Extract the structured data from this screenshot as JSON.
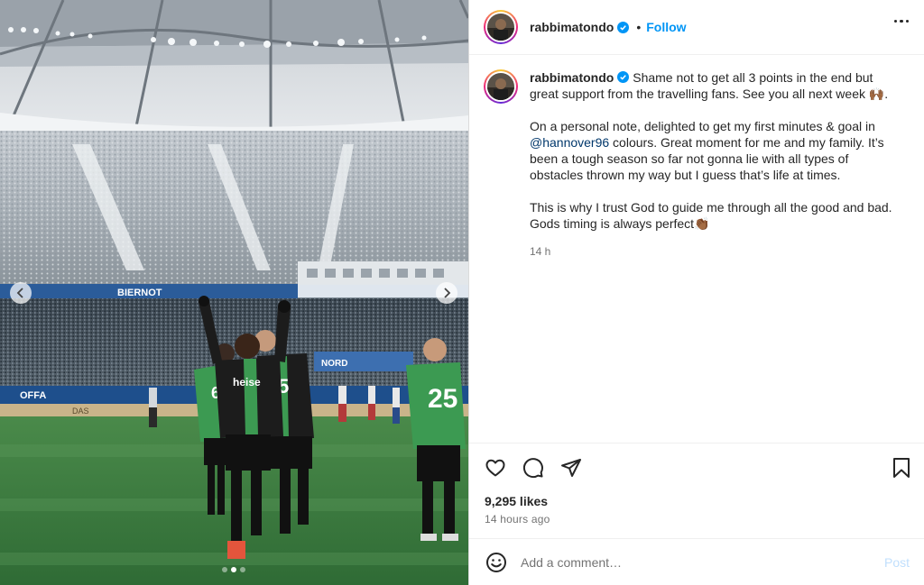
{
  "media": {
    "banner_text": "BIERNOT",
    "ad_board_left": "OFFA",
    "ad_board_mid": "DAS",
    "sign_right": "NORD",
    "jersey_sponsor": "heise",
    "jersey_number_main": "25",
    "jersey_number_center": "5",
    "jersey_number_left": "6",
    "carousel_dots": 3,
    "active_dot": 1
  },
  "header": {
    "username": "rabbimatondo",
    "separator": "•",
    "follow_label": "Follow"
  },
  "caption": {
    "username": "rabbimatondo",
    "paragraph1": "Shame not to get all 3 points in the end but great support from the travelling fans. See you all next week 🙌🏾.",
    "paragraph2_before": "On a personal note, delighted to get my first minutes & goal in ",
    "mention": "@hannover96",
    "paragraph2_after": " colours. Great moment for me and my family. It’s been a tough season so far not gonna lie with all types of obstacles thrown my way but I guess that’s life at times.",
    "paragraph3": "This is why I trust God to guide me through all the good and bad. Gods timing is always perfect👏🏾",
    "time": "14 h"
  },
  "actions": {
    "likes": "9,295 likes",
    "posted": "14 hours ago"
  },
  "comment": {
    "placeholder": "Add a comment…",
    "post_label": "Post"
  },
  "colors": {
    "accent": "#0095f6",
    "mention": "#00376b",
    "post_disabled": "#c0dffd",
    "hannover_green": "#2e8a46"
  },
  "icons": [
    "verified-icon",
    "more-options-icon",
    "heart-icon",
    "comment-icon",
    "share-icon",
    "bookmark-icon",
    "emoji-icon",
    "chevron-left-icon",
    "chevron-right-icon"
  ]
}
